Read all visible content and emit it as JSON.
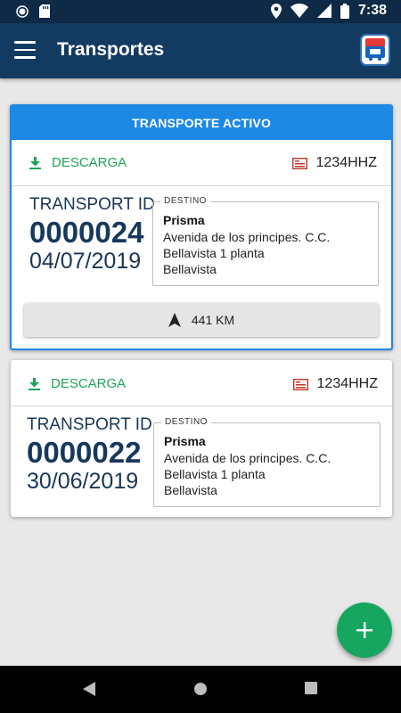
{
  "status_bar": {
    "time": "7:38",
    "icons": [
      "record-icon",
      "sd-card-icon",
      "location-icon",
      "wifi-icon",
      "signal-icon",
      "battery-icon"
    ]
  },
  "app_bar": {
    "title": "Transportes",
    "menu_icon": "hamburger-menu-icon",
    "logo_icon": "app-logo-icon"
  },
  "transports": [
    {
      "header": "TRANSPORTE ACTIVO",
      "type_icon": "download-icon",
      "type": "DESCARGA",
      "plate_icon": "truck-plate-icon",
      "plate": "1234HHZ",
      "id_label": "TRANSPORT ID",
      "id": "0000024",
      "date": "04/07/2019",
      "destination": {
        "legend": "DESTINO",
        "name": "Prisma",
        "lines": [
          "Avenida de los principes. C.C.",
          "Bellavista 1 planta",
          "Bellavista"
        ]
      },
      "distance_icon": "navigation-arrow-icon",
      "distance": "441 KM"
    },
    {
      "type_icon": "download-icon",
      "type": "DESCARGA",
      "plate_icon": "truck-plate-icon",
      "plate": "1234HHZ",
      "id_label": "TRANSPORT ID",
      "id": "0000022",
      "date": "30/06/2019",
      "destination": {
        "legend": "DESTINO",
        "name": "Prisma",
        "lines": [
          "Avenida de los principes. C.C.",
          "Bellavista 1 planta",
          "Bellavista"
        ]
      }
    }
  ],
  "fab": {
    "icon": "add-icon",
    "symbol": "+"
  },
  "nav_bar": {
    "icons": [
      "back-icon",
      "home-icon",
      "recents-icon"
    ]
  },
  "colors": {
    "status_bar": "#0e2a47",
    "app_bar": "#133a61",
    "accent_blue": "#1e88e5",
    "download_green": "#1da45a",
    "fab_green": "#16a65f",
    "plate_red": "#c0392b",
    "id_text": "#18375c"
  }
}
